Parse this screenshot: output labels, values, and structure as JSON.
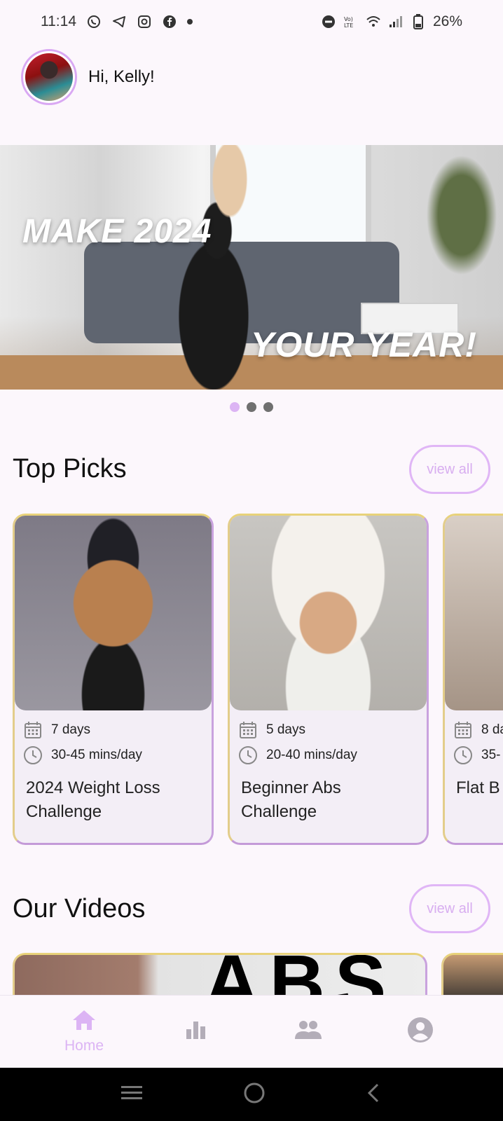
{
  "status_bar": {
    "time": "11:14",
    "left_icons": [
      "whatsapp-icon",
      "telegram-icon",
      "instagram-icon",
      "facebook-icon",
      "notification-dot"
    ],
    "right_icons": [
      "do-not-disturb-icon",
      "volte-icon",
      "wifi-icon",
      "signal-icon",
      "battery-icon"
    ],
    "battery": "26%"
  },
  "header": {
    "greeting": "Hi, Kelly!"
  },
  "banner": {
    "line1": "MAKE 2024",
    "line2": "YOUR YEAR!",
    "dots_total": 3,
    "active_dot": 1
  },
  "top_picks": {
    "title": "Top Picks",
    "view_all": "view all",
    "cards": [
      {
        "days": "7 days",
        "duration": "30-45 mins/day",
        "title": "2024 Weight Loss Challenge"
      },
      {
        "days": "5 days",
        "duration": "20-40 mins/day",
        "title": "Beginner Abs Challenge"
      },
      {
        "days": "8 da",
        "duration": "35-",
        "title": "Flat B"
      }
    ]
  },
  "our_videos": {
    "title": "Our Videos",
    "view_all": "view all",
    "thumb_text": "ABS"
  },
  "bottom_nav": {
    "home": "Home",
    "items": [
      "home-icon",
      "stats-icon",
      "community-icon",
      "profile-icon"
    ],
    "active": "Home"
  },
  "colors": {
    "accent": "#dcb4f4",
    "background": "#fcf7fc",
    "card_bg": "#f3eef6"
  }
}
